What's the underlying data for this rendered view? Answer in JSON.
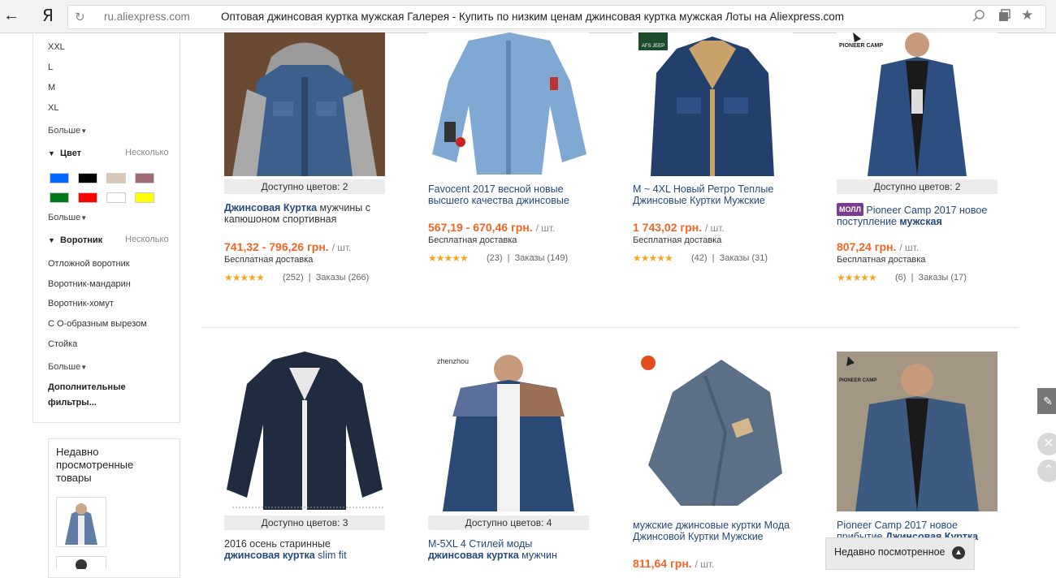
{
  "browser": {
    "domain": "ru.aliexpress.com",
    "title": "Оптовая джинсовая куртка мужская Галерея - Купить по низким ценам джинсовая куртка мужская Лоты на Aliexpress.com",
    "logo": "Я",
    "icons": [
      "back-arrow-icon",
      "reload-icon",
      "search-icon",
      "tabs-icon",
      "star-icon"
    ]
  },
  "sidebar": {
    "sizes": [
      "XXL",
      "L",
      "M",
      "XL"
    ],
    "more_label": "Больше",
    "color_section": {
      "title": "Цвет",
      "right": "Несколько",
      "swatches": [
        "#0066ff",
        "#000000",
        "#d9c8b8",
        "#9e6b73",
        "#007a1a",
        "#ff0000",
        "#ffffff",
        "#ffff00"
      ]
    },
    "collar_section": {
      "title": "Воротник",
      "right": "Несколько",
      "items": [
        "Отложной воротник",
        "Воротник-мандарин",
        "Воротник-хомут",
        "С О-образным вырезом",
        "Стойка"
      ]
    },
    "extra_filters": "Дополнительные фильтры...",
    "recent_title": "Недавно просмотренные товары"
  },
  "products": [
    {
      "colors": "Доступно цветов: 2",
      "title_bold": "Джинсовая Куртка",
      "title_rest": " мужчины с капюшоном спортивная",
      "price": "741,32 - 796,26 грн.",
      "unit": "/ шт.",
      "shipping": "Бесплатная доставка",
      "reviews": "(252)",
      "orders": "Заказы (266)"
    },
    {
      "colors": "",
      "title_bold": "",
      "title_rest": "Favocent 2017 весной новые высшего качества джинсовые",
      "price": "567,19 - 670,46 грн.",
      "unit": "/ шт.",
      "shipping": "Бесплатная доставка",
      "reviews": "(23)",
      "orders": "Заказы (149)"
    },
    {
      "colors": "",
      "title_bold": "",
      "title_rest": "M ~ 4XL Новый Ретро Теплые Джинсовые Куртки Мужские",
      "price": "1 743,02 грн.",
      "unit": "/ шт.",
      "shipping": "Бесплатная доставка",
      "reviews": "(42)",
      "orders": "Заказы (31)"
    },
    {
      "colors": "Доступно цветов: 2",
      "badge": "МОЛЛ",
      "title_rest": " Pioneer Camp 2017 новое поступление ",
      "title_bold": "мужская",
      "price": "807,24 грн.",
      "unit": "/ шт.",
      "shipping": "Бесплатная доставка",
      "reviews": "(6)",
      "orders": "Заказы (17)"
    },
    {
      "colors": "Доступно цветов: 3",
      "line1": "2016 осень старинные",
      "line2_bold": "джинсовая куртка",
      "line2_rest": " slim fit"
    },
    {
      "colors": "Доступно цветов: 4",
      "line1": "M-5XL 4 Стилей моды",
      "line2_bold": "джинсовая куртка",
      "line2_rest": " мужчин"
    },
    {
      "line1": "мужские джинсовые куртки Мода",
      "line2": "Джинсовой Куртки Мужские",
      "price": "811,64 грн.",
      "unit": "/ шт."
    },
    {
      "line1": "Pioneer Camp 2017 новое",
      "line2_rest": "прибытие ",
      "line2_bold": "Джинсовая Куртка"
    }
  ],
  "image_labels": {
    "afs": "AFS JEEP",
    "pioneer": "PIONEER CAMP",
    "zhenzhou": "zhenzhou"
  },
  "recent_popup": "Недавно посмотренное",
  "stars": "★★★★★"
}
